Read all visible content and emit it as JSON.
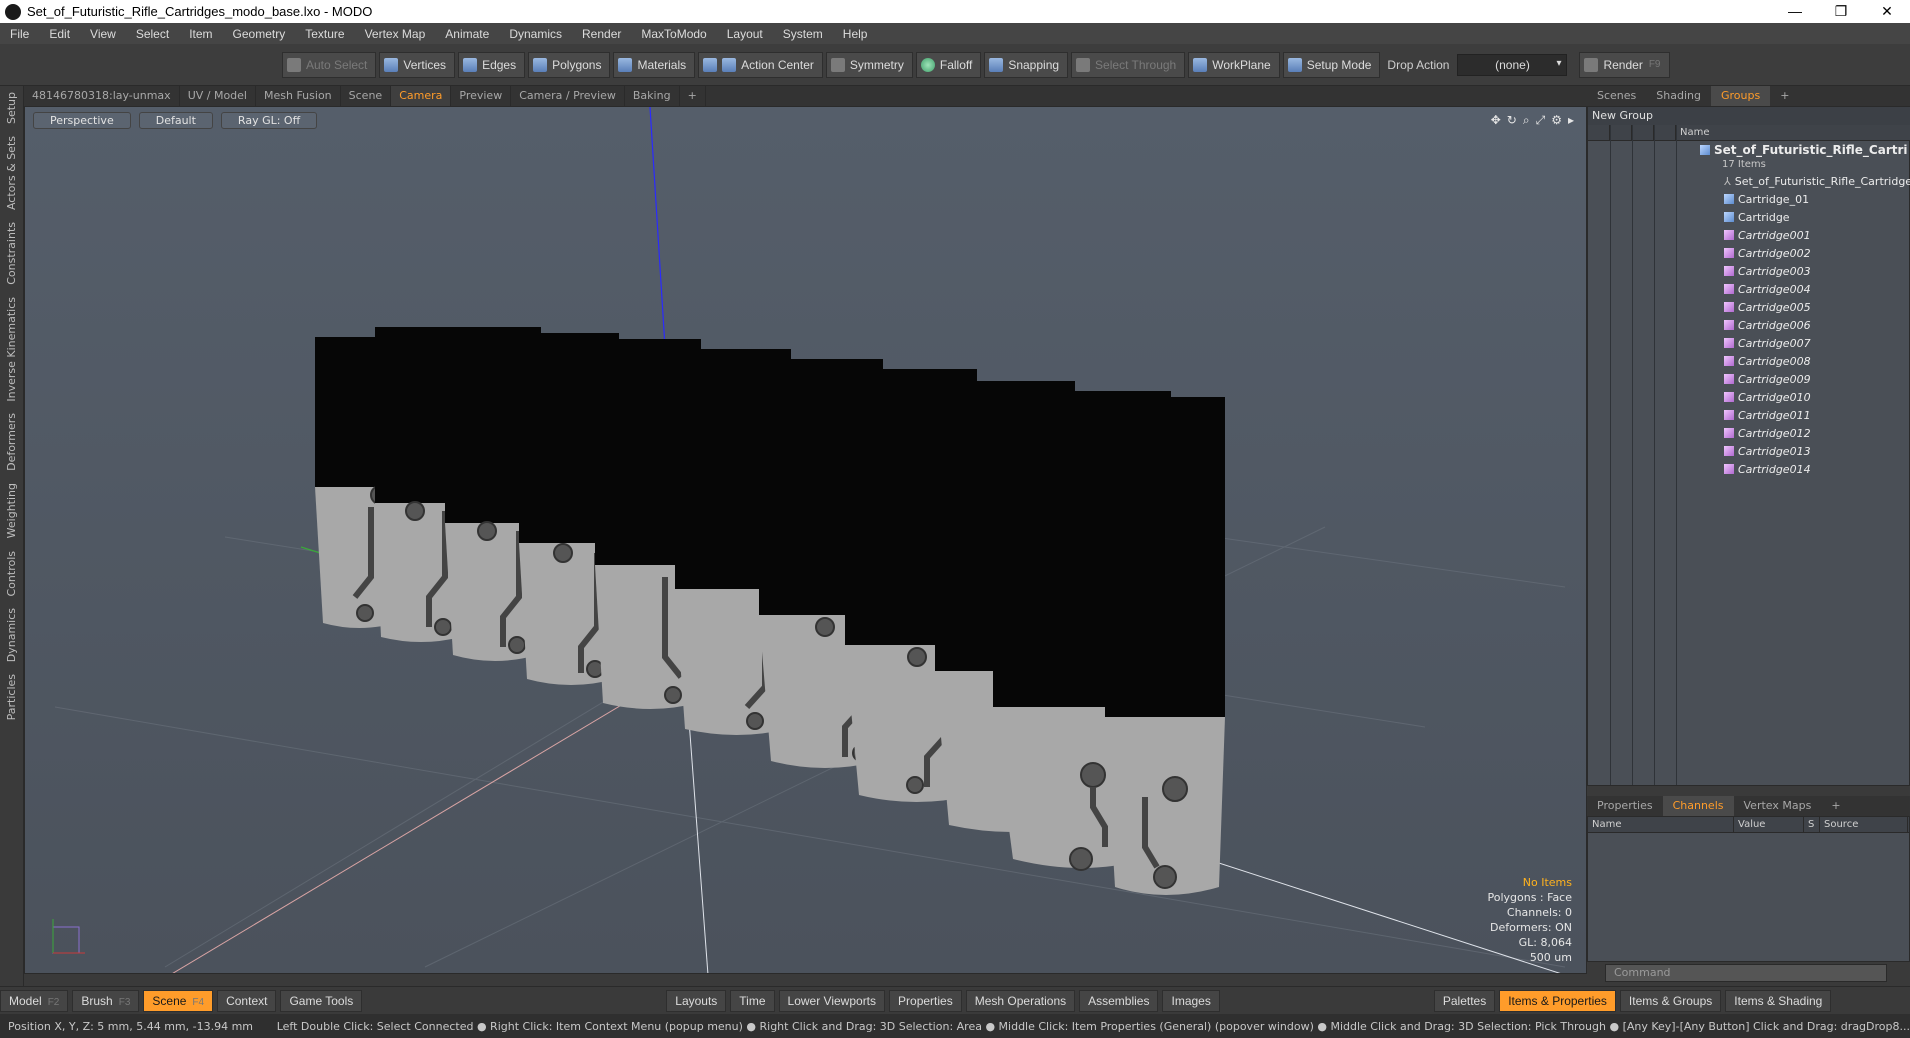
{
  "title": "Set_of_Futuristic_Rifle_Cartridges_modo_base.lxo - MODO",
  "window_controls": [
    "—",
    "❐",
    "✕"
  ],
  "menu": [
    "File",
    "Edit",
    "View",
    "Select",
    "Item",
    "Geometry",
    "Texture",
    "Vertex Map",
    "Animate",
    "Dynamics",
    "Render",
    "MaxToModo",
    "Layout",
    "System",
    "Help"
  ],
  "toolbar": {
    "auto_select": "Auto Select",
    "vertices": "Vertices",
    "edges": "Edges",
    "polygons": "Polygons",
    "materials": "Materials",
    "action_center": "Action Center",
    "symmetry": "Symmetry",
    "falloff": "Falloff",
    "snapping": "Snapping",
    "select_through": "Select Through",
    "workplane": "WorkPlane",
    "setup_mode": "Setup Mode",
    "drop_action_label": "Drop Action",
    "drop_action_value": "(none)",
    "render": "Render",
    "render_key": "F9"
  },
  "left_rail": [
    "Setup",
    "Actors & Sets",
    "Constraints",
    "Inverse Kinematics",
    "Deformers",
    "Weighting",
    "Controls",
    "Dynamics",
    "Particles"
  ],
  "viewport_tabs": [
    "48146780318:lay-unmax",
    "UV / Model",
    "Mesh Fusion",
    "Scene",
    "Camera",
    "Preview",
    "Camera / Preview",
    "Baking",
    "+"
  ],
  "viewport": {
    "view": "Perspective",
    "shading": "Default",
    "raygl": "Ray GL: Off",
    "info": {
      "items": "No Items",
      "polygons": "Polygons : Face",
      "channels": "Channels: 0",
      "deformers": "Deformers: ON",
      "gl": "GL: 8,064",
      "scale": "500 um"
    }
  },
  "right_tabs": [
    "Scenes",
    "Shading",
    "Groups",
    "+"
  ],
  "groups": {
    "new_group": "New Group",
    "name_col": "Name",
    "root": "Set_of_Futuristic_Rifle_Cartri ...",
    "root_count": "17 Items",
    "items": [
      {
        "label": "Set_of_Futuristic_Rifle_Cartridges",
        "kind": "locator",
        "italic": false
      },
      {
        "label": "Cartridge_01",
        "kind": "mesh-blue",
        "italic": false
      },
      {
        "label": "Cartridge",
        "kind": "mesh-blue",
        "italic": false
      },
      {
        "label": "Cartridge001",
        "kind": "mesh-pink",
        "italic": true
      },
      {
        "label": "Cartridge002",
        "kind": "mesh-pink",
        "italic": true
      },
      {
        "label": "Cartridge003",
        "kind": "mesh-pink",
        "italic": true
      },
      {
        "label": "Cartridge004",
        "kind": "mesh-pink",
        "italic": true
      },
      {
        "label": "Cartridge005",
        "kind": "mesh-pink",
        "italic": true
      },
      {
        "label": "Cartridge006",
        "kind": "mesh-pink",
        "italic": true
      },
      {
        "label": "Cartridge007",
        "kind": "mesh-pink",
        "italic": true
      },
      {
        "label": "Cartridge008",
        "kind": "mesh-pink",
        "italic": true
      },
      {
        "label": "Cartridge009",
        "kind": "mesh-pink",
        "italic": true
      },
      {
        "label": "Cartridge010",
        "kind": "mesh-pink",
        "italic": true
      },
      {
        "label": "Cartridge011",
        "kind": "mesh-pink",
        "italic": true
      },
      {
        "label": "Cartridge012",
        "kind": "mesh-pink",
        "italic": true
      },
      {
        "label": "Cartridge013",
        "kind": "mesh-pink",
        "italic": true
      },
      {
        "label": "Cartridge014",
        "kind": "mesh-pink",
        "italic": true
      }
    ]
  },
  "props_tabs": [
    "Properties",
    "Channels",
    "Vertex Maps",
    "+"
  ],
  "props_cols": [
    "Name",
    "Value",
    "S",
    "Source"
  ],
  "command_placeholder": "Command",
  "bottom": {
    "model": "Model",
    "model_key": "F2",
    "brush": "Brush",
    "brush_key": "F3",
    "scene": "Scene",
    "scene_key": "F4",
    "context": "Context",
    "game_tools": "Game Tools",
    "layouts": "Layouts",
    "time": "Time",
    "lower_viewports": "Lower Viewports",
    "properties": "Properties",
    "mesh_operations": "Mesh Operations",
    "assemblies": "Assemblies",
    "images": "Images",
    "palettes": "Palettes",
    "items_properties": "Items & Properties",
    "items_groups": "Items & Groups",
    "items_shading": "Items & Shading"
  },
  "status": {
    "position": "Position X, Y, Z:   5 mm, 5.44 mm, -13.94 mm",
    "hints": "Left Double Click: Select Connected ● Right Click: Item Context Menu (popup menu) ● Right Click and Drag: 3D Selection: Area ● Middle Click: Item Properties (General) (popover window) ● Middle Click and Drag: 3D Selection: Pick Through ● [Any Key]-[Any Button] Click and Drag: dragDrop8..."
  }
}
